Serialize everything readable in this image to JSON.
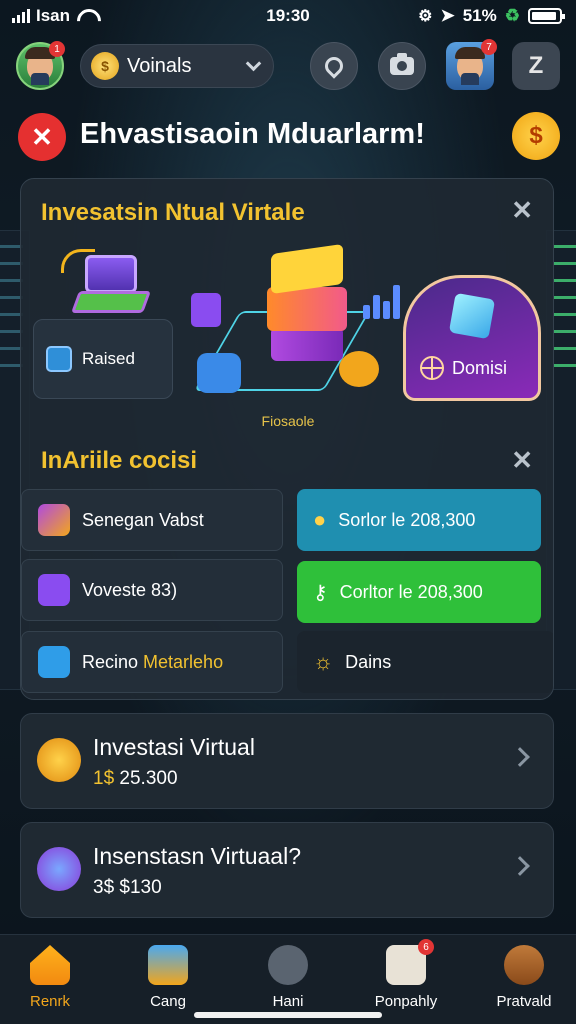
{
  "status_bar": {
    "carrier": "Isan",
    "time": "19:30",
    "battery": "51%"
  },
  "header": {
    "avatar_badge": "1",
    "selector_label": "Voinals",
    "coin_glyph": "$",
    "right_avatar_badge": "7",
    "z_button": "Z"
  },
  "title_row": {
    "title": "Ehvastisaoin Mduarlarm!",
    "coin_glyph": "$"
  },
  "card": {
    "title": "Invesatsin Ntual Virtale",
    "raised_label": "Raised",
    "frame_label": "Fiosaole",
    "domain_label": "Domisi",
    "section_title": "InAriile cocisi",
    "actions": [
      {
        "label": "Senegan Vabst"
      },
      {
        "label": "Sorlor le 208,300"
      },
      {
        "label": "Voveste 83)"
      },
      {
        "label": "Corltor le 208,300"
      },
      {
        "label_a": "Recino ",
        "label_b": "Metarleho"
      },
      {
        "label": "Dains"
      }
    ]
  },
  "list": [
    {
      "title": "Investasi Virtual",
      "prefix": "1$",
      "value": "25.300"
    },
    {
      "title": "Insenstasn Virtuaal?",
      "prefix": "3$",
      "value": "$130"
    }
  ],
  "bottom_nav": {
    "tabs": [
      {
        "label": "Renrk",
        "active": true,
        "badge": ""
      },
      {
        "label": "Cang",
        "active": false,
        "badge": ""
      },
      {
        "label": "Hani",
        "active": false,
        "badge": ""
      },
      {
        "label": "Ponpahly",
        "active": false,
        "badge": "6"
      },
      {
        "label": "Pratvald",
        "active": false,
        "badge": ""
      }
    ]
  },
  "colors": {
    "accent_gold": "#f2c230",
    "alert_red": "#e53030",
    "teal_button": "#1f8fb0",
    "green_button": "#2fc03a",
    "background": "#0c1720"
  }
}
